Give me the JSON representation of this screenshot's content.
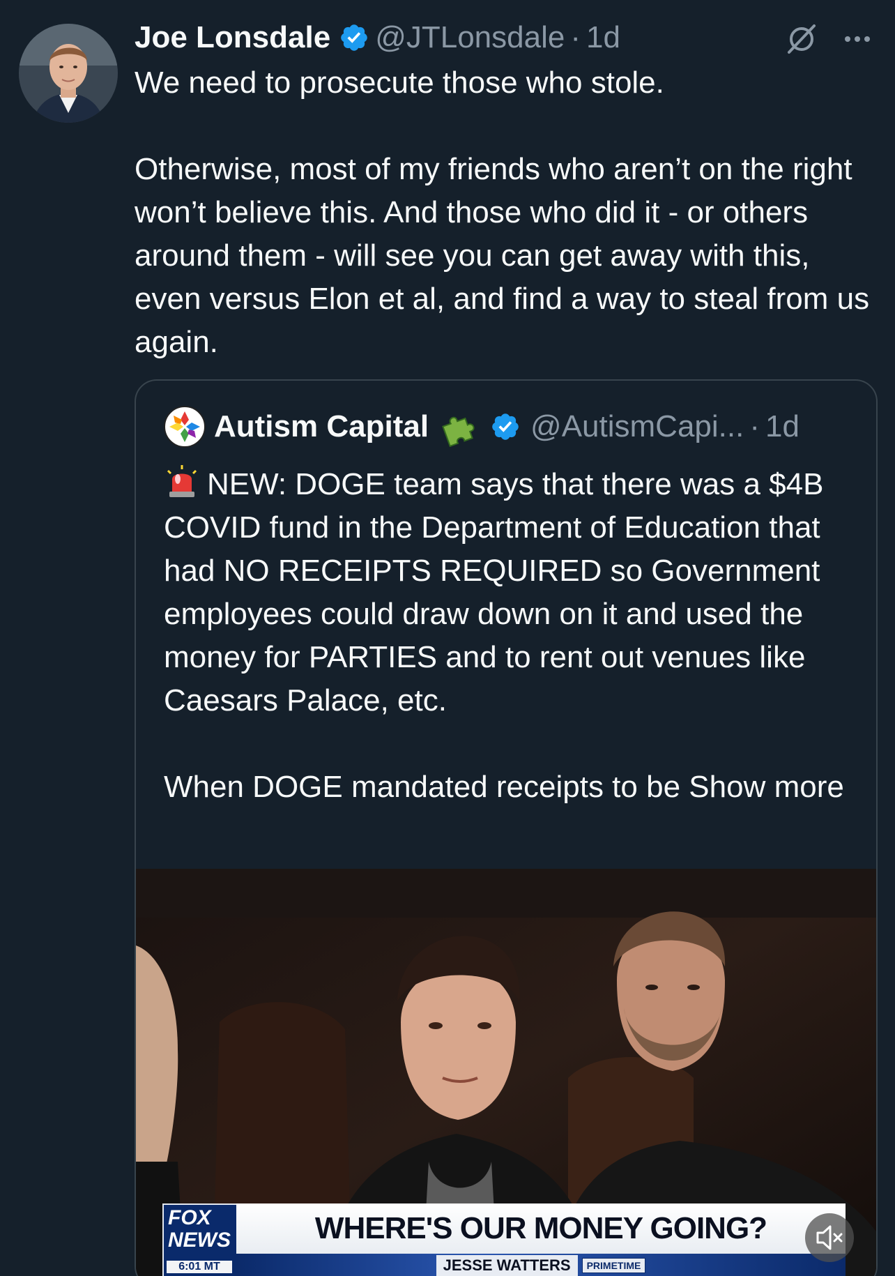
{
  "tweet": {
    "author": {
      "name": "Joe Lonsdale",
      "handle": "@JTLonsdale",
      "dot": "·",
      "time": "1d",
      "verified": true
    },
    "icons": {
      "avatar": "profile-photo",
      "verified": "verified-badge-icon",
      "grok": "grok-icon",
      "more": "more-options-icon"
    },
    "text": [
      "We need to prosecute those who stole.",
      "Otherwise, most of my friends who aren’t on the right won’t believe this. And those who did it - or others around them - will see you can get away with this, even versus Elon et al, and find a way to steal from us again."
    ],
    "colors": {
      "background": "#15202b",
      "text": "#f7f9f9",
      "secondary": "#8b98a5",
      "verified": "#1d9bf0",
      "border": "#38444d"
    }
  },
  "quote": {
    "author": {
      "name": "Autism Capital",
      "handle": "@AutismCapi...",
      "dot": "·",
      "time": "1d",
      "verified": true
    },
    "icons": {
      "avatar": "autism-capital-logo",
      "name_emoji": "puzzle-piece-icon",
      "lead_emoji": "siren-icon"
    },
    "text": [
      "NEW: DOGE team says that there was a $4B COVID fund in the Department of Education that had NO RECEIPTS REQUIRED so Government employees could draw down on it and used the money for PARTIES and to rent out venues like Caesars Palace, etc.",
      "When DOGE mandated receipts to be"
    ],
    "show_more": "Show more",
    "media": {
      "type": "video",
      "logo_line1": "FOX",
      "logo_line2": "NEWS",
      "logo_time": "6:01 MT",
      "headline": "WHERE'S OUR MONEY GOING?",
      "show_name": "JESSE WATTERS",
      "show_tag": "PRIMETIME",
      "mute_icon": "volume-muted-icon"
    }
  }
}
